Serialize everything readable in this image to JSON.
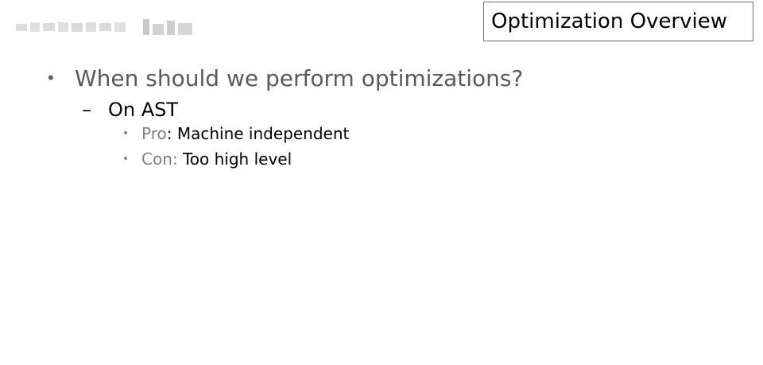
{
  "slide": {
    "title": "Optimization Overview",
    "bullets": {
      "question": "When should we perform optimizations?",
      "option": "On AST",
      "pro_label": "Pro",
      "pro_text": ": Machine independent",
      "con_label": "Con:",
      "con_text": " Too high level"
    }
  },
  "icons": {
    "bullet_main": "•",
    "bullet_sub": "•",
    "dash": "–",
    "watermark": "watermark-logo-icon"
  },
  "colors": {
    "title_border": "#6e6e6e",
    "question_text": "#5a5a5a",
    "sub_bullet": "#7f7f7f",
    "text": "#000000"
  }
}
